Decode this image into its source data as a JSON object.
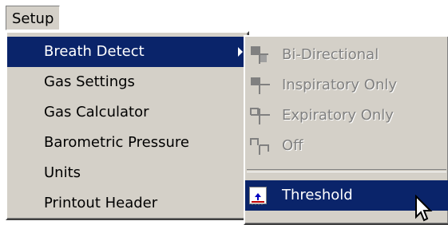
{
  "menubar": {
    "setup_label": "Setup"
  },
  "setup_menu": {
    "items": [
      {
        "label": "Breath Detect",
        "has_submenu": true,
        "selected": true
      },
      {
        "label": "Gas Settings"
      },
      {
        "label": "Gas Calculator"
      },
      {
        "label": "Barometric Pressure"
      },
      {
        "label": "Units"
      },
      {
        "label": "Printout Header"
      }
    ]
  },
  "breath_detect_submenu": {
    "items": [
      {
        "label": "Bi-Directional",
        "enabled": false,
        "icon": "bidirectional-icon"
      },
      {
        "label": "Inspiratory Only",
        "enabled": false,
        "icon": "inspiratory-icon"
      },
      {
        "label": "Expiratory Only",
        "enabled": false,
        "icon": "expiratory-icon"
      },
      {
        "label": "Off",
        "enabled": false,
        "icon": "off-icon"
      }
    ],
    "threshold_label": "Threshold",
    "threshold_icon": "threshold-icon"
  },
  "colors": {
    "menu_bg": "#d4d0c8",
    "selection": "#0a246a",
    "disabled_text": "#808080"
  }
}
